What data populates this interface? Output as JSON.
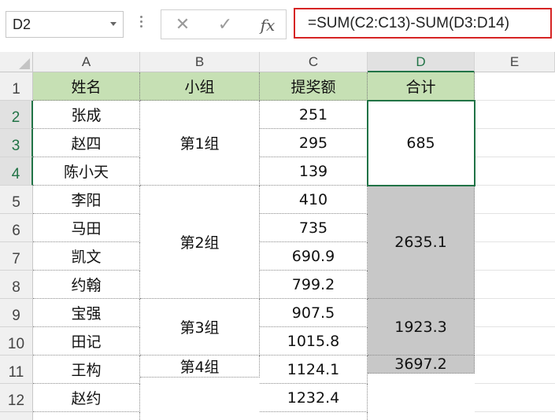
{
  "namebox": {
    "value": "D2"
  },
  "formula_bar": {
    "cancel_icon": "✕",
    "enter_icon": "✓",
    "fx_label": "fx",
    "formula": "=SUM(C2:C13)-SUM(D3:D14)"
  },
  "columns": [
    "A",
    "B",
    "C",
    "D",
    "E"
  ],
  "rows": [
    "1",
    "2",
    "3",
    "4",
    "5",
    "6",
    "7",
    "8",
    "9",
    "10",
    "11",
    "12"
  ],
  "header": {
    "name": "姓名",
    "group": "小组",
    "bonus": "提奖额",
    "total": "合计"
  },
  "names": [
    "张成",
    "赵四",
    "陈小天",
    "李阳",
    "马田",
    "凯文",
    "约翰",
    "宝强",
    "田记",
    "王构",
    "赵约",
    ""
  ],
  "groups": [
    "第1组",
    "第2组",
    "第3组",
    "第4组"
  ],
  "bonuses": [
    "251",
    "295",
    "139",
    "410",
    "735",
    "690.9",
    "799.2",
    "907.5",
    "1015.8",
    "1124.1",
    "1232.4",
    ""
  ],
  "totals": [
    "685",
    "2635.1",
    "1923.3",
    "3697.2"
  ],
  "colors": {
    "header_fill": "#c6e0b4",
    "selection": "#217346",
    "formula_border": "#d62424",
    "grey_fill": "#c8c8c8"
  }
}
